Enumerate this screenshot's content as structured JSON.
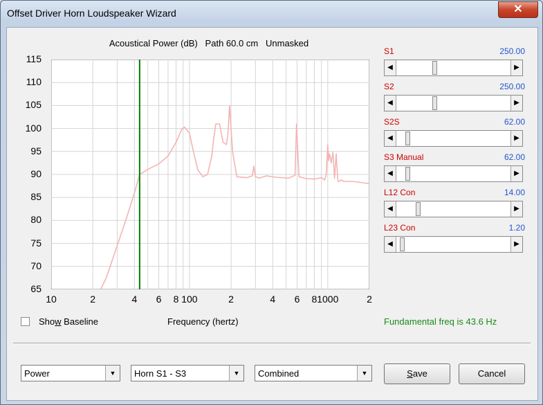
{
  "window": {
    "title": "Offset Driver Horn Loudspeaker Wizard",
    "close_glyph": "✕"
  },
  "chart_header": "Acoustical Power (dB)   Path 60.0 cm   Unmasked",
  "chart_data": {
    "type": "line",
    "title": "Acoustical Power (dB)   Path 60.0 cm   Unmasked",
    "xlabel": "Frequency (hertz)",
    "ylabel": "",
    "x_scale": "log",
    "xlim": [
      10,
      2000
    ],
    "ylim": [
      65,
      115
    ],
    "y_ticks": [
      "115",
      "110",
      "105",
      "100",
      "95",
      "90",
      "85",
      "80",
      "75",
      "70",
      "65"
    ],
    "x_tick_labels": [
      {
        "value": 10,
        "label": "10"
      },
      {
        "value": 20,
        "label": "2"
      },
      {
        "value": 40,
        "label": "4"
      },
      {
        "value": 60,
        "label": "6"
      },
      {
        "value": 80,
        "label": "8"
      },
      {
        "value": 100,
        "label": "100"
      },
      {
        "value": 200,
        "label": "2"
      },
      {
        "value": 400,
        "label": "4"
      },
      {
        "value": 600,
        "label": "6"
      },
      {
        "value": 800,
        "label": "8"
      },
      {
        "value": 1000,
        "label": "1000"
      },
      {
        "value": 2000,
        "label": "2"
      }
    ],
    "grid": true,
    "marker_line": {
      "x": 43.6,
      "color": "#007a00"
    },
    "series": [
      {
        "color": "#f4b4b4",
        "x": [
          22.8,
          25,
          30,
          35,
          40,
          43.6,
          50,
          60,
          70,
          80,
          88,
          92,
          100,
          105,
          115,
          125,
          135,
          145,
          150,
          155,
          165,
          175,
          185,
          190,
          195,
          205,
          220,
          260,
          285,
          292,
          300,
          320,
          360,
          420,
          520,
          580,
          595,
          605,
          620,
          700,
          800,
          900,
          950,
          975,
          1000,
          1015,
          1030,
          1060,
          1090,
          1120,
          1150,
          1180,
          1200,
          1250,
          1300,
          1500,
          1800,
          2000
        ],
        "y": [
          65,
          67.5,
          74.5,
          80.5,
          86,
          90,
          91.1,
          92.3,
          94,
          97,
          99.8,
          100.3,
          99,
          96,
          91,
          89.5,
          90,
          94,
          98,
          101,
          101,
          97,
          96.5,
          99,
          105,
          95,
          89.5,
          89.3,
          89.7,
          91.8,
          89.5,
          89.2,
          89.7,
          89.4,
          89.2,
          89.8,
          101,
          96,
          89.5,
          89.1,
          89,
          89.3,
          88.8,
          90,
          96.5,
          93,
          94.5,
          92.5,
          94.8,
          89.2,
          94.5,
          89,
          88.4,
          88.8,
          88.5,
          88.5,
          88.2,
          88
        ]
      }
    ]
  },
  "sliders": [
    {
      "label": "S1",
      "value": "250.00",
      "position": 0.33
    },
    {
      "label": "S2",
      "value": "250.00",
      "position": 0.33
    },
    {
      "label": "S2S",
      "value": "62.00",
      "position": 0.08
    },
    {
      "label": "S3  Manual",
      "value": "62.00",
      "position": 0.08
    },
    {
      "label": "L12  Con",
      "value": "14.00",
      "position": 0.18
    },
    {
      "label": "L23  Con",
      "value": "1.20",
      "position": 0.03
    }
  ],
  "show_baseline": {
    "label_pre": "Sho",
    "label_ul": "w",
    "label_post": " Baseline",
    "checked": false
  },
  "frequency_label": "Frequency (hertz)",
  "fundamental": "Fundamental freq is 43.6 Hz",
  "combos": [
    {
      "value": "Power"
    },
    {
      "value": "Horn S1 - S3"
    },
    {
      "value": "Combined"
    }
  ],
  "buttons": {
    "save_ul": "S",
    "save_rest": "ave",
    "cancel": "Cancel"
  },
  "colors": {
    "curve": "#f4b4b4",
    "marker": "#007a00",
    "slider_label": "#cc0000",
    "slider_value": "#2255cc",
    "fundamental": "#1a8a1a"
  }
}
